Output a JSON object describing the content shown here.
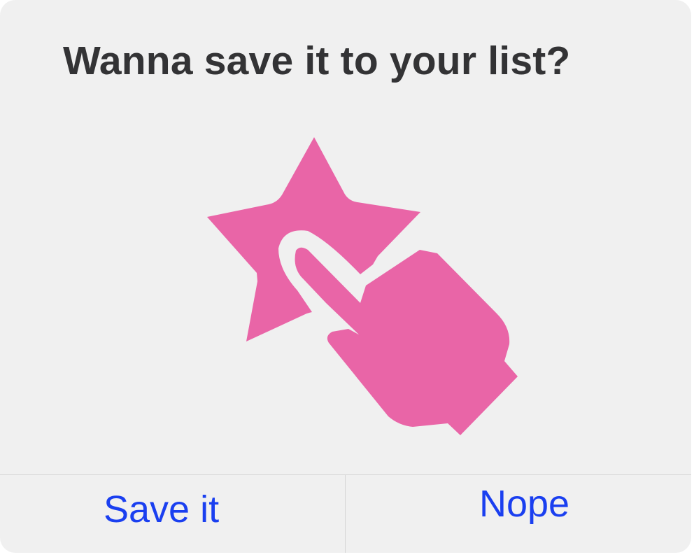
{
  "dialog": {
    "title": "Wanna save it to your list?",
    "illustration": {
      "icon": "star-with-pointing-hand-icon",
      "color": "#e965a7"
    },
    "buttons": {
      "confirm_label": "Save it",
      "cancel_label": "Nope"
    },
    "colors": {
      "background": "#f0f0f0",
      "title": "#333335",
      "button_text": "#1a3ff0",
      "separator": "#d6d6d6"
    }
  }
}
